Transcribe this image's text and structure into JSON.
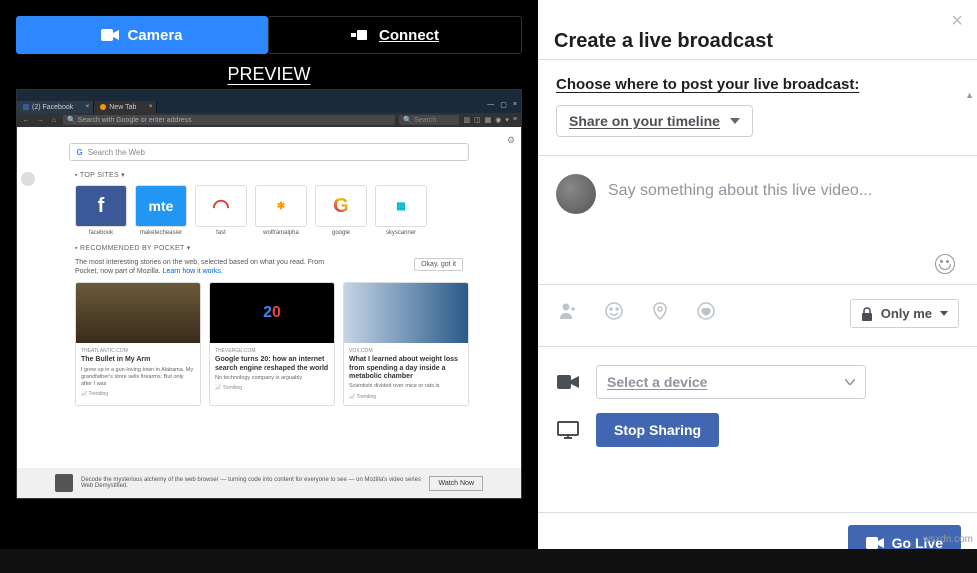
{
  "tabs": {
    "camera": "Camera",
    "connect": "Connect"
  },
  "preview_label": "PREVIEW",
  "firefox": {
    "tab1": "(2) Facebook",
    "tab2": "New Tab",
    "url_placeholder": "Search with Google or enter address",
    "search_placeholder": "Search",
    "big_search": "Search the Web",
    "top_sites_label": "TOP SITES",
    "sites": [
      {
        "label": "facebook",
        "letter": "f",
        "color": "#3b5998"
      },
      {
        "label": "maketecheasier",
        "letter": "mte",
        "color": "#2196f3"
      },
      {
        "label": "fast",
        "letter": "◠",
        "color": "#e53935"
      },
      {
        "label": "wolframalpha",
        "letter": "✱",
        "color": "#ff9800"
      },
      {
        "label": "google",
        "letter": "G",
        "color": "#4285f4"
      },
      {
        "label": "skyscanner",
        "letter": "▦",
        "color": "#00b4d8"
      }
    ],
    "pocket_label": "RECOMMENDED BY POCKET",
    "pocket_text": "The most interesting stories on the web, selected based on what you read. From Pocket, now part of Mozilla.",
    "pocket_link": "Learn how it works.",
    "pocket_okay": "Okay, got it",
    "articles": [
      {
        "domain": "THEATLANTIC.COM",
        "title": "The Bullet in My Arm",
        "snippet": "I grew up in a gun-loving town in Alabama. My grandfather's store sells firearms. But only after I was",
        "trending": "Trending"
      },
      {
        "domain": "THEVERGE.COM",
        "title": "Google turns 20: how an internet search engine reshaped the world",
        "snippet": "No technology company is arguably",
        "trending": "Trending"
      },
      {
        "domain": "VOX.COM",
        "title": "What I learned about weight loss from spending a day inside a metabolic chamber",
        "snippet": "Scientists divided over mice or rats is",
        "trending": "Trending"
      }
    ],
    "bottom_text": "Decode the mysterious alchemy of the web browser — turning code into content for everyone to see — on Mozilla's video series Web Demystified.",
    "watch_now": "Watch Now"
  },
  "broadcast": {
    "title": "Create a live broadcast",
    "choose": "Choose where to post your live broadcast:",
    "share_option": "Share on your timeline",
    "placeholder": "Say something about this live video...",
    "privacy": "Only me",
    "select_device": "Select a device",
    "stop_sharing": "Stop Sharing",
    "go_live": "Go Live"
  },
  "watermark": "wsxdn.com"
}
